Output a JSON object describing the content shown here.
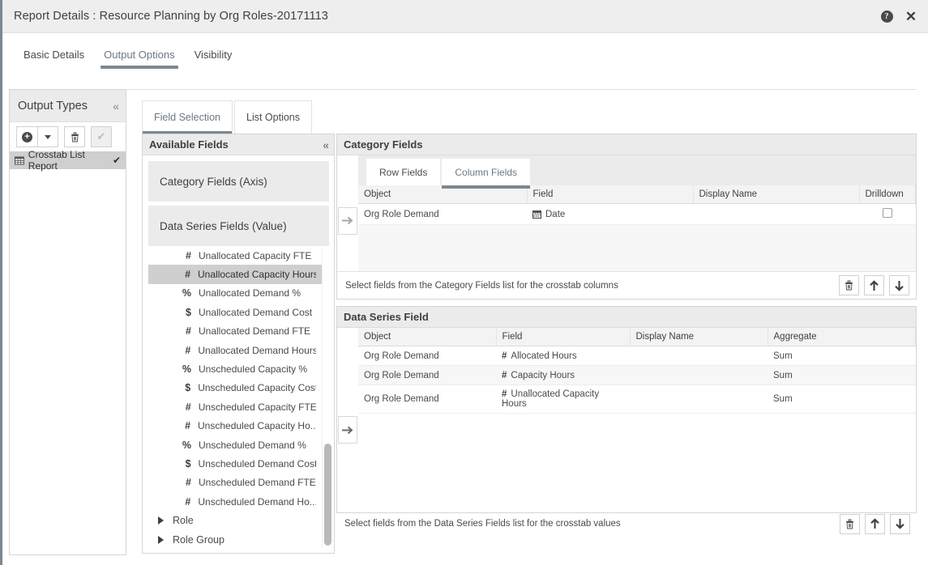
{
  "window": {
    "title": "Report Details : Resource Planning by Org Roles-20171113",
    "help_icon": "help-circle-icon",
    "close_icon": "close-icon"
  },
  "main_tabs": [
    {
      "label": "Basic Details",
      "active": false
    },
    {
      "label": "Output Options",
      "active": true
    },
    {
      "label": "Visibility",
      "active": false
    }
  ],
  "output_types": {
    "title": "Output Types",
    "collapse_icon": "«",
    "toolbar": {
      "add_label": "+",
      "add_icon": "plus-circle-icon",
      "dropdown_icon": "caret-down-icon",
      "delete_icon": "trash-icon",
      "confirm_icon": "check-icon"
    },
    "items": [
      {
        "label": "Crosstab List Report",
        "icon": "grid-icon",
        "selected_mark": "✔",
        "selected": true
      }
    ]
  },
  "sub_tabs": [
    {
      "label": "Field Selection",
      "active": true
    },
    {
      "label": "List Options",
      "active": false
    }
  ],
  "available_fields": {
    "title": "Available Fields",
    "collapse_icon": "«",
    "accordions": [
      {
        "label": "Category Fields (Axis)"
      },
      {
        "label": "Data Series Fields (Value)"
      }
    ],
    "fields": [
      {
        "icon": "#",
        "label": "Unallocated Capacity FTE",
        "selected": false
      },
      {
        "icon": "#",
        "label": "Unallocated Capacity Hours",
        "selected": true
      },
      {
        "icon": "%",
        "label": "Unallocated Demand %",
        "selected": false
      },
      {
        "icon": "$",
        "label": "Unallocated Demand Cost",
        "selected": false
      },
      {
        "icon": "#",
        "label": "Unallocated Demand FTE",
        "selected": false
      },
      {
        "icon": "#",
        "label": "Unallocated Demand Hours",
        "selected": false
      },
      {
        "icon": "%",
        "label": "Unscheduled Capacity %",
        "selected": false
      },
      {
        "icon": "$",
        "label": "Unscheduled Capacity Cost",
        "selected": false
      },
      {
        "icon": "#",
        "label": "Unscheduled Capacity FTE",
        "selected": false
      },
      {
        "icon": "#",
        "label": "Unscheduled Capacity Ho...",
        "selected": false
      },
      {
        "icon": "%",
        "label": "Unscheduled Demand %",
        "selected": false
      },
      {
        "icon": "$",
        "label": "Unscheduled Demand Cost",
        "selected": false
      },
      {
        "icon": "#",
        "label": "Unscheduled Demand FTE",
        "selected": false
      },
      {
        "icon": "#",
        "label": "Unscheduled Demand Ho...",
        "selected": false
      }
    ],
    "tree_items": [
      {
        "label": "Role",
        "expanded": false
      },
      {
        "label": "Role Group",
        "expanded": false
      }
    ]
  },
  "category_fields": {
    "title": "Category Fields",
    "move_icon": "arrow-right-icon",
    "tabs": [
      {
        "label": "Row Fields",
        "active": false
      },
      {
        "label": "Column Fields",
        "active": true
      }
    ],
    "columns": [
      "Object",
      "Field",
      "Display Name",
      "Drilldown"
    ],
    "rows": [
      {
        "object": "Org Role Demand",
        "field": "Date",
        "field_icon": "calendar-icon",
        "display_name": "",
        "drilldown_checked": false
      }
    ],
    "hint": "Select fields from the Category Fields list for the crosstab columns",
    "buttons": {
      "delete_icon": "trash-icon",
      "move_up_icon": "arrow-up-icon",
      "move_down_icon": "arrow-down-icon"
    }
  },
  "data_series_field": {
    "title": "Data Series Field",
    "move_icon": "arrow-right-icon",
    "columns": [
      "Object",
      "Field",
      "Display Name",
      "Aggregate"
    ],
    "rows": [
      {
        "object": "Org Role Demand",
        "field": "Allocated Hours",
        "field_icon": "#",
        "display_name": "",
        "aggregate": "Sum"
      },
      {
        "object": "Org Role Demand",
        "field": "Capacity Hours",
        "field_icon": "#",
        "display_name": "",
        "aggregate": "Sum"
      },
      {
        "object": "Org Role Demand",
        "field": "Unallocated Capacity Hours",
        "field_icon": "#",
        "display_name": "",
        "aggregate": "Sum"
      }
    ],
    "hint": "Select fields from the Data Series Fields list for the crosstab values",
    "buttons": {
      "delete_icon": "trash-icon",
      "move_up_icon": "arrow-up-icon",
      "move_down_icon": "arrow-down-icon"
    }
  },
  "colors": {
    "accent": "#7b8794",
    "header_bg": "#ebebeb",
    "selection_bg": "#cfcfcf",
    "titlebar_bg": "#eeeeee"
  }
}
